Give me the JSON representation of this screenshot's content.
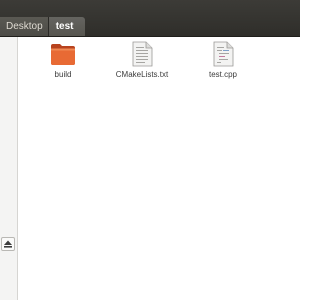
{
  "pathbar": {
    "crumbs": [
      {
        "label": "Desktop",
        "active": false
      },
      {
        "label": "test",
        "active": true
      }
    ]
  },
  "sidebar": {
    "eject_icon": "eject-icon"
  },
  "files": [
    {
      "name": "build",
      "icon": "folder-icon"
    },
    {
      "name": "CMakeLists.txt",
      "icon": "text-file-icon"
    },
    {
      "name": "test.cpp",
      "icon": "cpp-file-icon"
    }
  ],
  "colors": {
    "titlebar": "#3c3b37",
    "folder_orange": "#e15c2c",
    "background": "#ffffff"
  }
}
